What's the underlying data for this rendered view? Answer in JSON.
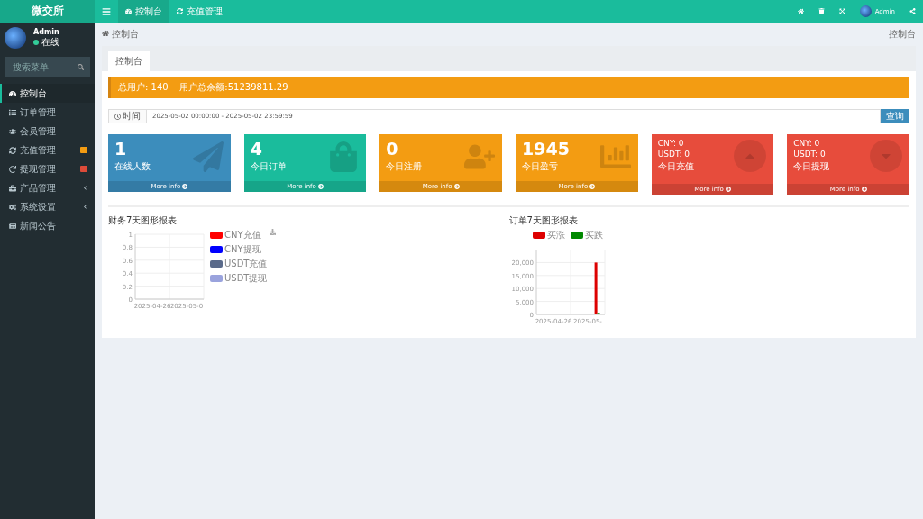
{
  "brand": "微交所",
  "topnav": [
    {
      "label": "控制台",
      "selected": true
    },
    {
      "label": "充值管理",
      "selected": false
    }
  ],
  "top_user": "Admin",
  "user": {
    "name": "Admin",
    "status": "在线"
  },
  "sidebar": {
    "search": {
      "placeholder": "搜索菜单"
    },
    "items": [
      {
        "label": "控制台",
        "selected": true
      },
      {
        "label": "订单管理",
        "selected": false
      },
      {
        "label": "会员管理",
        "selected": false
      },
      {
        "label": "充值管理",
        "selected": false,
        "color": "#f39c12"
      },
      {
        "label": "提现管理",
        "selected": false,
        "color": "#dd4b39"
      },
      {
        "label": "产品管理",
        "selected": false,
        "expandable": true
      },
      {
        "label": "系统设置",
        "selected": false,
        "expandable": true
      },
      {
        "label": "新闻公告",
        "selected": false
      }
    ]
  },
  "breadcrumb": "控制台",
  "page_title": "控制台",
  "tabs": [
    {
      "label": "控制台",
      "selected": true
    }
  ],
  "alert": "总用户: 140    用户总余额:51239811.29",
  "filter": {
    "label": "时间",
    "value": "2025-05-02 00:00:00 - 2025-05-02 23:59:59",
    "button": "查询"
  },
  "cards": [
    {
      "kind": "number",
      "value": "1",
      "label": "在线人数",
      "color": "#3c8dbc",
      "more": "More info"
    },
    {
      "kind": "number",
      "value": "4",
      "label": "今日订单",
      "color": "#1abc9c",
      "more": "More info"
    },
    {
      "kind": "number",
      "value": "0",
      "label": "今日注册",
      "color": "#f39c12",
      "more": "More info"
    },
    {
      "kind": "number",
      "value": "1945",
      "label": "今日盈亏",
      "color": "#f39c12",
      "more": "More info"
    },
    {
      "kind": "money",
      "lines": [
        "CNY:  0",
        "USDT:  0"
      ],
      "label": "今日充值",
      "color": "#e74c3c",
      "more": "More info"
    },
    {
      "kind": "money",
      "lines": [
        "CNY:  0",
        "USDT:  0"
      ],
      "label": "今日提现",
      "color": "#e74c3c",
      "more": "More info"
    }
  ],
  "charts": [
    {
      "title": "财务7天图形报表",
      "chart_data": {
        "type": "line",
        "categories": [
          "2025-04-26",
          "2025-05-0"
        ],
        "ylim": [
          0,
          1
        ],
        "yticks": [
          0,
          0.2,
          0.4,
          0.6,
          0.8,
          1
        ],
        "grid": true,
        "legend": "right",
        "series": [
          {
            "name": "CNY充值",
            "color": "#ff0000",
            "values": [
              null,
              null
            ]
          },
          {
            "name": "CNY提现",
            "color": "#0000ff",
            "values": [
              null,
              null
            ]
          },
          {
            "name": "USDT充值",
            "color": "#5a6a8a",
            "values": [
              null,
              null
            ]
          },
          {
            "name": "USDT提现",
            "color": "#9aa3dd",
            "values": [
              null,
              null
            ]
          }
        ]
      }
    },
    {
      "title": "订单7天图形报表",
      "chart_data": {
        "type": "bar",
        "categories": [
          "2025-04-26",
          "2025-05-"
        ],
        "ylim": [
          0,
          25000
        ],
        "yticks": [
          0,
          {
            "value": 5000,
            "label": "5,000"
          },
          {
            "value": 10000,
            "label": "10,000"
          },
          {
            "value": 15000,
            "label": "15,000"
          },
          {
            "value": 20000,
            "label": "20,000"
          }
        ],
        "grid": true,
        "legend": "top",
        "series": [
          {
            "name": "买涨",
            "color": "#dd0000",
            "values": [
              0,
              20000
            ]
          },
          {
            "name": "买跌",
            "color": "#008800",
            "values": [
              0,
              600
            ]
          }
        ]
      }
    }
  ]
}
